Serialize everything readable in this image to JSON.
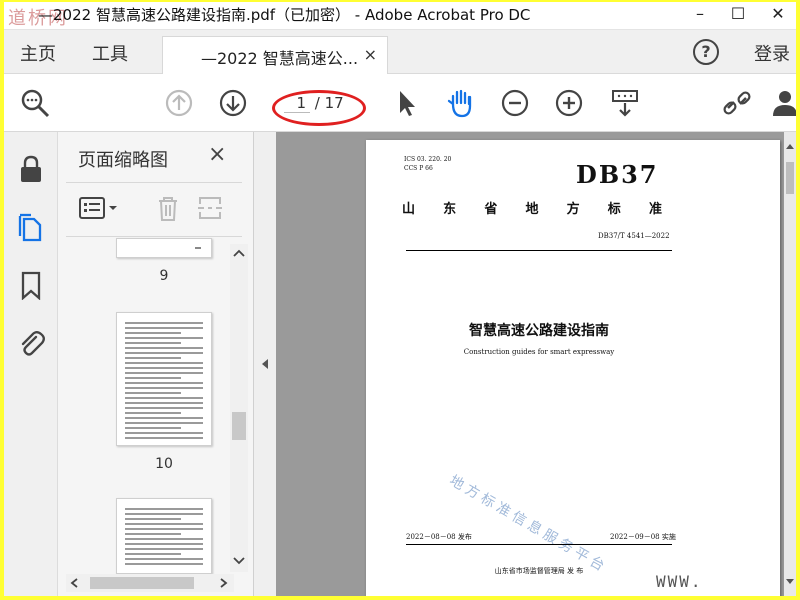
{
  "window": {
    "watermark": "道桥网",
    "title": "—2022 智慧高速公路建设指南.pdf（已加密） - Adobe Acrobat Pro DC",
    "min": "–",
    "max": "☐",
    "close": "✕"
  },
  "menu": {
    "home": "主页",
    "tools": "工具",
    "tab_label": "—2022 智慧高速公...",
    "tab_close": "×",
    "help": "?",
    "login": "登录"
  },
  "toolbar": {
    "current_page": "1",
    "total_pages": "/ 17"
  },
  "thumbnails": {
    "title": "页面缩略图",
    "close": "×",
    "pages": [
      {
        "number": "9"
      },
      {
        "number": "10"
      }
    ]
  },
  "document": {
    "ics": "ICS  03. 220. 20",
    "ccs": "CCS  P  66",
    "standard": "DB37",
    "province_chars": [
      "山",
      "东",
      "省",
      "地",
      "方",
      "标",
      "准"
    ],
    "code": "DB37/T  4541—2022",
    "title_cn": "智慧高速公路建设指南",
    "title_en": "Construction guides for smart expressway",
    "watermark": "地方标准信息服务平台",
    "issue_date": "2022－08－08 发布",
    "effective_date": "2022－09－08 实施",
    "issuer": "山东省市场监督管理局    发  布"
  },
  "footer_watermark": "WWW.",
  "colors": {
    "border": "#ffff33",
    "highlight": "#e02020",
    "accent": "#1473e6"
  }
}
